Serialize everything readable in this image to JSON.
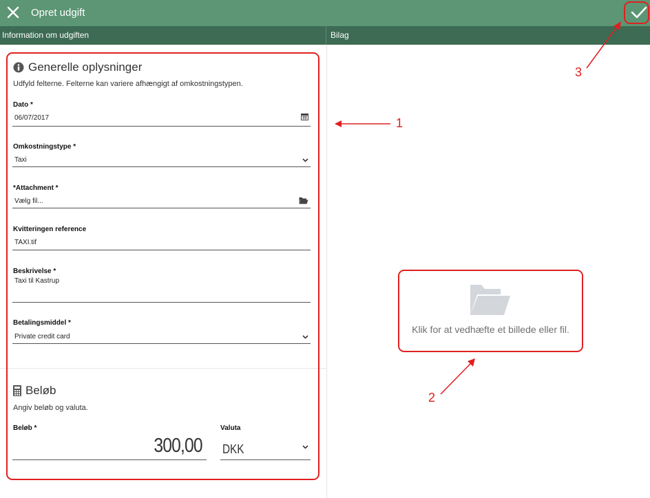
{
  "header": {
    "title": "Opret udgift"
  },
  "subheader": {
    "left_label": "Information om udgiften",
    "right_label": "Bilag"
  },
  "general": {
    "title": "Generelle oplysninger",
    "hint": "Udfyld felterne. Felterne kan variere afhængigt af omkostningstypen.",
    "date_label": "Dato *",
    "date_value": "06/07/2017",
    "type_label": "Omkostningstype *",
    "type_value": "Taxi",
    "attachment_label": "*Attachment *",
    "attachment_value": "Vælg fil...",
    "receipt_label": "Kvitteringen reference",
    "receipt_value": "TAXI.tif",
    "description_label": "Beskrivelse *",
    "description_value": "Taxi til Kastrup",
    "payment_label": "Betalingsmiddel *",
    "payment_value": "Private credit card"
  },
  "amount": {
    "title": "Beløb",
    "hint": "Angiv beløb og valuta.",
    "amount_label": "Beløb *",
    "amount_value": "300,00",
    "currency_label": "Valuta",
    "currency_value": "DKK"
  },
  "attachments": {
    "upload_text": "Klik for at vedhæfte et billede eller fil."
  },
  "annotations": {
    "one": "1",
    "two": "2",
    "three": "3"
  },
  "colors": {
    "header": "#5c9674",
    "subheader": "#3d6b53",
    "annotation": "#e02020"
  }
}
